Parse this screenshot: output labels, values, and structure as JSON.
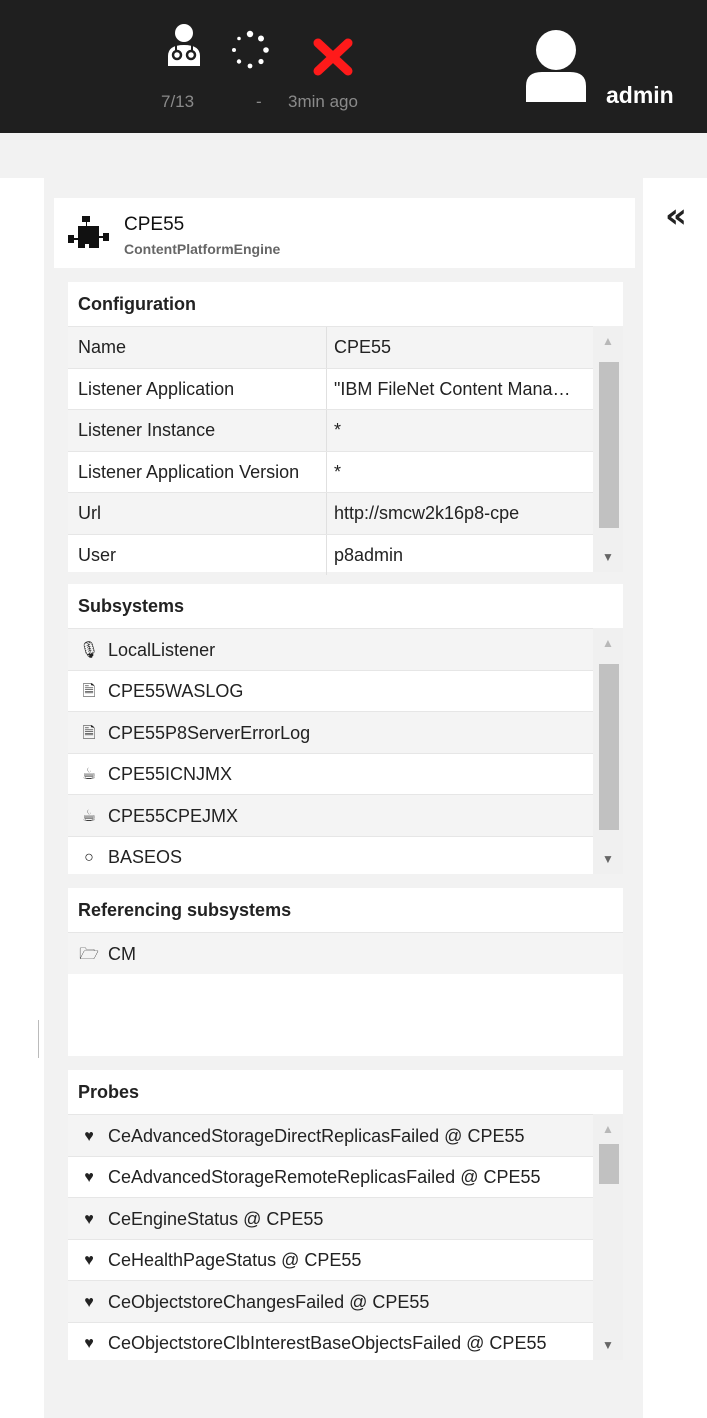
{
  "topbar": {
    "health_count": "7/13",
    "status_dash": "-",
    "last_check": "3min ago",
    "user_name": "admin",
    "error_color": "#ff1a1a"
  },
  "header": {
    "title": "CPE55",
    "subtitle": "ContentPlatformEngine",
    "icon": "puzzle-icon"
  },
  "configuration": {
    "title": "Configuration",
    "rows": [
      {
        "key": "Name",
        "value": "CPE55"
      },
      {
        "key": "Listener Application",
        "value": "\"IBM FileNet Content Manager\""
      },
      {
        "key": "Listener Instance",
        "value": "*"
      },
      {
        "key": "Listener Application Version",
        "value": "*"
      },
      {
        "key": "Url",
        "value": "http://smcw2k16p8-cpe"
      },
      {
        "key": "User",
        "value": "p8admin"
      }
    ],
    "scroll_fraction": 0.72
  },
  "subsystems": {
    "title": "Subsystems",
    "items": [
      {
        "icon": "microphone-icon",
        "glyph": "🎙",
        "label": "LocalListener"
      },
      {
        "icon": "file-icon",
        "glyph": "🗎",
        "label": "CPE55WASLOG"
      },
      {
        "icon": "file-icon",
        "glyph": "🗎",
        "label": "CPE55P8ServerErrorLog"
      },
      {
        "icon": "coffee-icon",
        "glyph": "☕",
        "label": "CPE55ICNJMX"
      },
      {
        "icon": "coffee-icon",
        "glyph": "☕",
        "label": "CPE55CPEJMX"
      },
      {
        "icon": "circle-icon",
        "glyph": "○",
        "label": "BASEOS"
      }
    ]
  },
  "referencing": {
    "title": "Referencing subsystems",
    "items": [
      {
        "icon": "folder-open-icon",
        "glyph": "🗁",
        "label": "CM"
      }
    ]
  },
  "probes": {
    "title": "Probes",
    "items": [
      {
        "icon": "heartbeat-icon",
        "label": "CeAdvancedStorageDirectReplicasFailed @ CPE55"
      },
      {
        "icon": "heartbeat-icon",
        "label": "CeAdvancedStorageRemoteReplicasFailed @ CPE55"
      },
      {
        "icon": "heartbeat-icon",
        "label": "CeEngineStatus @ CPE55"
      },
      {
        "icon": "heartbeat-icon",
        "label": "CeHealthPageStatus @ CPE55"
      },
      {
        "icon": "heartbeat-icon",
        "label": "CeObjectstoreChangesFailed @ CPE55"
      },
      {
        "icon": "heartbeat-icon",
        "label": "CeObjectstoreClbInterestBaseObjectsFailed @ CPE55"
      }
    ]
  }
}
